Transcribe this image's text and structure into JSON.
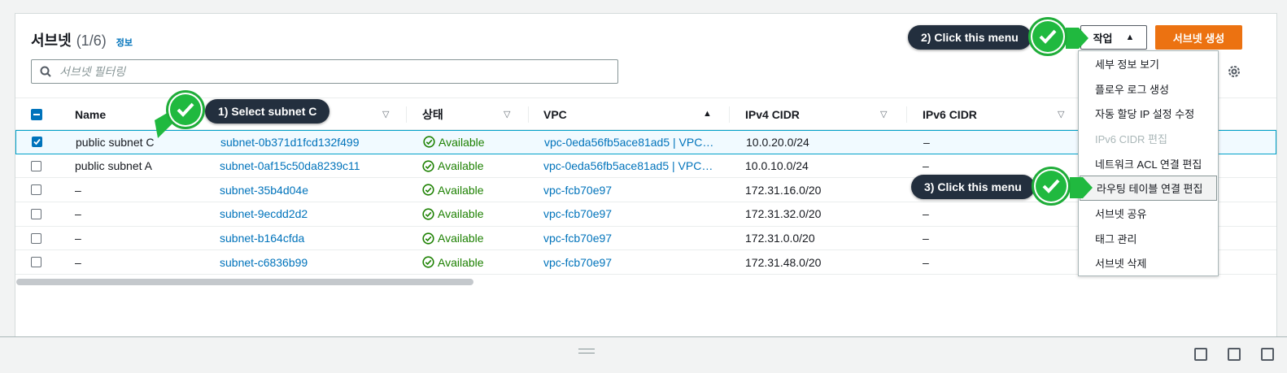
{
  "header": {
    "title": "서브넷",
    "count": "(1/6)",
    "info_link": "정보",
    "actions_label": "작업",
    "create_label": "서브넷 생성"
  },
  "search": {
    "placeholder": "서브넷 필터링"
  },
  "table": {
    "columns": [
      "Name",
      "",
      "상태",
      "VPC",
      "IPv4 CIDR",
      "IPv6 CIDR"
    ],
    "rows": [
      {
        "name": "public subnet C",
        "id": "subnet-0b371d1fcd132f499",
        "state": "Available",
        "vpc": "vpc-0eda56fb5ace81ad5 | VPC…",
        "ipv4": "10.0.20.0/24",
        "ipv6": "–",
        "checked": true
      },
      {
        "name": "public subnet A",
        "id": "subnet-0af15c50da8239c11",
        "state": "Available",
        "vpc": "vpc-0eda56fb5ace81ad5 | VPC…",
        "ipv4": "10.0.10.0/24",
        "ipv6": "–",
        "checked": false
      },
      {
        "name": "–",
        "id": "subnet-35b4d04e",
        "state": "Available",
        "vpc": "vpc-fcb70e97",
        "ipv4": "172.31.16.0/20",
        "ipv6": "–",
        "checked": false
      },
      {
        "name": "–",
        "id": "subnet-9ecdd2d2",
        "state": "Available",
        "vpc": "vpc-fcb70e97",
        "ipv4": "172.31.32.0/20",
        "ipv6": "–",
        "checked": false
      },
      {
        "name": "–",
        "id": "subnet-b164cfda",
        "state": "Available",
        "vpc": "vpc-fcb70e97",
        "ipv4": "172.31.0.0/20",
        "ipv6": "–",
        "checked": false
      },
      {
        "name": "–",
        "id": "subnet-c6836b99",
        "state": "Available",
        "vpc": "vpc-fcb70e97",
        "ipv4": "172.31.48.0/20",
        "ipv6": "–",
        "checked": false
      }
    ]
  },
  "menu": {
    "items": [
      {
        "label": "세부 정보 보기",
        "disabled": false
      },
      {
        "label": "플로우 로그 생성",
        "disabled": false
      },
      {
        "label": "자동 할당 IP 설정 수정",
        "disabled": false
      },
      {
        "label": "IPv6 CIDR 편집",
        "disabled": true
      },
      {
        "label": "네트워크 ACL 연결 편집",
        "disabled": false
      },
      {
        "label": "라우팅 테이블 연결 편집",
        "disabled": false,
        "hover": true
      },
      {
        "label": "서브넷 공유",
        "disabled": false
      },
      {
        "label": "태그 관리",
        "disabled": false
      },
      {
        "label": "서브넷 삭제",
        "disabled": false
      }
    ]
  },
  "callouts": {
    "step1": "1) Select subnet C",
    "step2": "2) Click this menu",
    "step3": "3) Click this menu"
  },
  "colors": {
    "accent": "#ec7211",
    "link": "#0073bb",
    "success": "#1d8102",
    "callout_bg": "#232f3e",
    "badge_green": "#20b93f"
  }
}
